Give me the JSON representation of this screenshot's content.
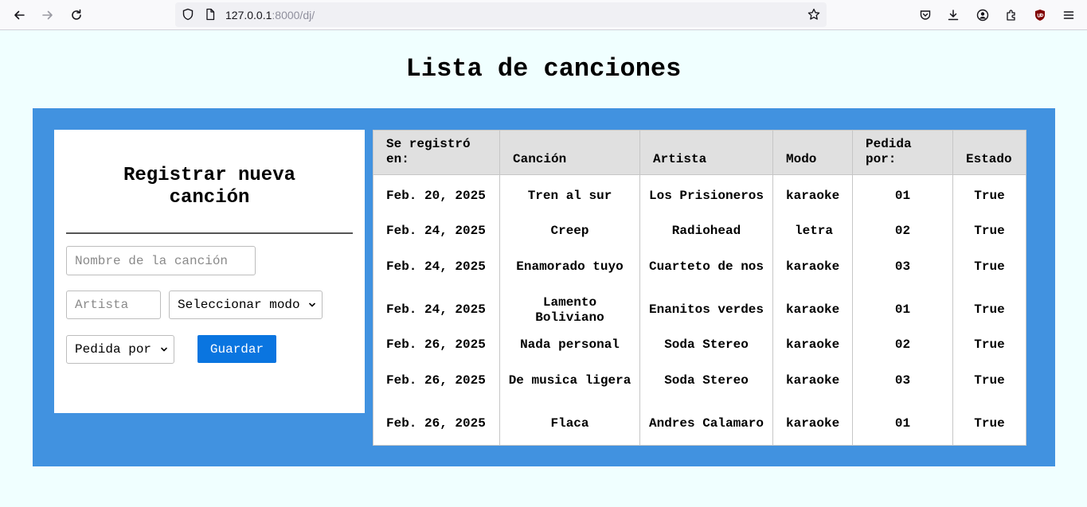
{
  "browser": {
    "url_host": "127.0.0.1",
    "url_rest": ":8000/dj/"
  },
  "page": {
    "title": "Lista de canciones"
  },
  "form": {
    "title": "Registrar nueva canción",
    "song_placeholder": "Nombre de la canción",
    "artist_placeholder": "Artista",
    "mode_select": "Seleccionar modo",
    "requested_select": "Pedida por",
    "save_label": "Guardar"
  },
  "table": {
    "headers": [
      "Se registró en:",
      "Canción",
      "Artista",
      "Modo",
      "Pedida por:",
      "Estado"
    ],
    "rows": [
      {
        "date": "Feb. 20, 2025",
        "song": "Tren al sur",
        "artist": "Los Prisioneros",
        "mode": "karaoke",
        "by": "01",
        "status": "True"
      },
      {
        "date": "Feb. 24, 2025",
        "song": "Creep",
        "artist": "Radiohead",
        "mode": "letra",
        "by": "02",
        "status": "True"
      },
      {
        "date": "Feb. 24, 2025",
        "song": "Enamorado tuyo",
        "artist": "Cuarteto de nos",
        "mode": "karaoke",
        "by": "03",
        "status": "True"
      },
      {
        "date": "Feb. 24, 2025",
        "song": "Lamento Boliviano",
        "artist": "Enanitos verdes",
        "mode": "karaoke",
        "by": "01",
        "status": "True"
      },
      {
        "date": "Feb. 26, 2025",
        "song": "Nada personal",
        "artist": "Soda Stereo",
        "mode": "karaoke",
        "by": "02",
        "status": "True"
      },
      {
        "date": "Feb. 26, 2025",
        "song": "De musica ligera",
        "artist": "Soda Stereo",
        "mode": "karaoke",
        "by": "03",
        "status": "True"
      },
      {
        "date": "Feb. 26, 2025",
        "song": "Flaca",
        "artist": "Andres Calamaro",
        "mode": "karaoke",
        "by": "01",
        "status": "True"
      }
    ]
  },
  "colors": {
    "page_bg": "#f0ffff",
    "panel_bg": "#4192e0",
    "button_bg": "#0a75e0",
    "header_bg": "#e0e0e0"
  }
}
